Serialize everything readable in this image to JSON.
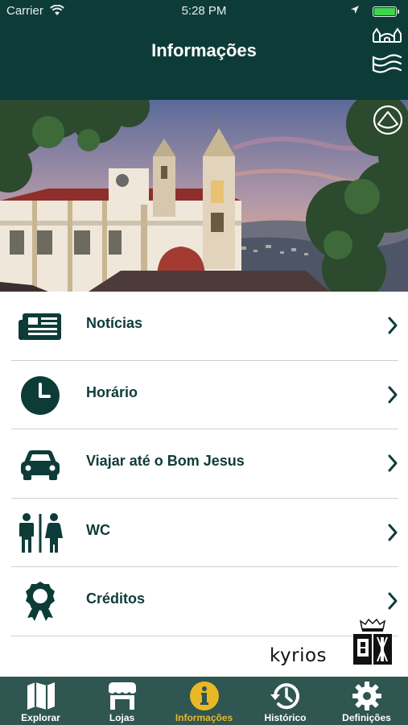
{
  "status_bar": {
    "carrier": "Carrier",
    "time": "5:28 PM",
    "battery_level": 1.0
  },
  "nav_bar": {
    "title": "Informações",
    "icons": [
      "sanctuary-icon",
      "water-icon"
    ]
  },
  "hero": {
    "icon": "heritage-icon"
  },
  "menu": {
    "items": [
      {
        "label": "Notícias",
        "icon": "newspaper-icon"
      },
      {
        "label": "Horário",
        "icon": "clock-icon"
      },
      {
        "label": "Viajar até o Bom Jesus",
        "icon": "car-icon"
      },
      {
        "label": "WC",
        "icon": "restroom-icon"
      },
      {
        "label": "Créditos",
        "icon": "award-icon"
      }
    ]
  },
  "logos": {
    "kyrios": "kyrios",
    "crest_icon": "coat-of-arms-icon"
  },
  "tab_bar": {
    "tabs": [
      {
        "label": "Explorar",
        "icon": "map-icon",
        "active": false
      },
      {
        "label": "Lojas",
        "icon": "store-icon",
        "active": false
      },
      {
        "label": "Informações",
        "icon": "info-icon",
        "active": true
      },
      {
        "label": "Histórico",
        "icon": "history-icon",
        "active": false
      },
      {
        "label": "Definições",
        "icon": "settings-gear-icon",
        "active": false
      }
    ]
  },
  "colors": {
    "primary": "#0d3c38",
    "tab_bar": "#2f5650",
    "accent": "#e9b826",
    "divider": "#cfcfcf"
  }
}
